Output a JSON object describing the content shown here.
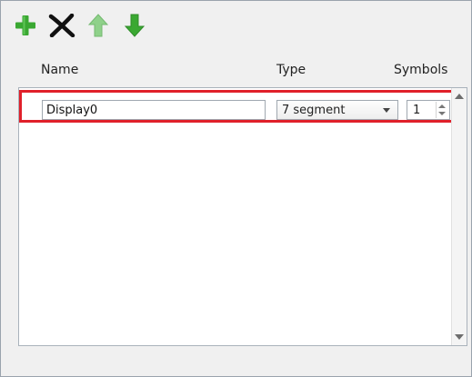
{
  "toolbar": {
    "add_icon": "plus-icon",
    "remove_icon": "x-icon",
    "up_icon": "arrow-up-icon",
    "down_icon": "arrow-down-icon",
    "colors": {
      "add": "#3aa832",
      "remove": "#111111",
      "up": "#8fd18a",
      "down": "#3aa832"
    }
  },
  "headers": {
    "name": "Name",
    "type": "Type",
    "symbols": "Symbols"
  },
  "rows": [
    {
      "name": "Display0",
      "type": "7 segment",
      "symbols": "1"
    }
  ],
  "highlight_color": "#e0202a"
}
